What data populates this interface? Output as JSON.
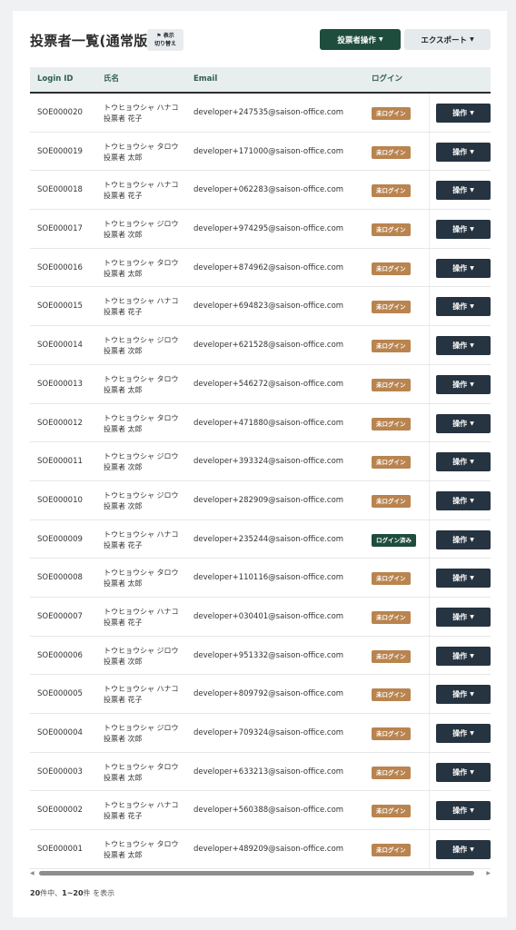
{
  "header": {
    "title": "投票者一覧(通常版)",
    "toggle_line1": "表示",
    "toggle_line2": "切り替え",
    "voter_ops_label": "投票者操作",
    "export_label": "エクスポート"
  },
  "table": {
    "columns": [
      "Login ID",
      "氏名",
      "Email",
      "ログイン"
    ],
    "op_label": "操作",
    "rows": [
      {
        "id": "SOE000020",
        "kana": "トウヒョウシャ ハナコ",
        "name": "投票者 花子",
        "email": "developer+247535@saison-office.com",
        "status": "未ログイン",
        "logged": false
      },
      {
        "id": "SOE000019",
        "kana": "トウヒョウシャ タロウ",
        "name": "投票者 太郎",
        "email": "developer+171000@saison-office.com",
        "status": "未ログイン",
        "logged": false
      },
      {
        "id": "SOE000018",
        "kana": "トウヒョウシャ ハナコ",
        "name": "投票者 花子",
        "email": "developer+062283@saison-office.com",
        "status": "未ログイン",
        "logged": false
      },
      {
        "id": "SOE000017",
        "kana": "トウヒョウシャ ジロウ",
        "name": "投票者 次郎",
        "email": "developer+974295@saison-office.com",
        "status": "未ログイン",
        "logged": false
      },
      {
        "id": "SOE000016",
        "kana": "トウヒョウシャ タロウ",
        "name": "投票者 太郎",
        "email": "developer+874962@saison-office.com",
        "status": "未ログイン",
        "logged": false
      },
      {
        "id": "SOE000015",
        "kana": "トウヒョウシャ ハナコ",
        "name": "投票者 花子",
        "email": "developer+694823@saison-office.com",
        "status": "未ログイン",
        "logged": false
      },
      {
        "id": "SOE000014",
        "kana": "トウヒョウシャ ジロウ",
        "name": "投票者 次郎",
        "email": "developer+621528@saison-office.com",
        "status": "未ログイン",
        "logged": false
      },
      {
        "id": "SOE000013",
        "kana": "トウヒョウシャ タロウ",
        "name": "投票者 太郎",
        "email": "developer+546272@saison-office.com",
        "status": "未ログイン",
        "logged": false
      },
      {
        "id": "SOE000012",
        "kana": "トウヒョウシャ タロウ",
        "name": "投票者 太郎",
        "email": "developer+471880@saison-office.com",
        "status": "未ログイン",
        "logged": false
      },
      {
        "id": "SOE000011",
        "kana": "トウヒョウシャ ジロウ",
        "name": "投票者 次郎",
        "email": "developer+393324@saison-office.com",
        "status": "未ログイン",
        "logged": false
      },
      {
        "id": "SOE000010",
        "kana": "トウヒョウシャ ジロウ",
        "name": "投票者 次郎",
        "email": "developer+282909@saison-office.com",
        "status": "未ログイン",
        "logged": false
      },
      {
        "id": "SOE000009",
        "kana": "トウヒョウシャ ハナコ",
        "name": "投票者 花子",
        "email": "developer+235244@saison-office.com",
        "status": "ログイン済み",
        "logged": true
      },
      {
        "id": "SOE000008",
        "kana": "トウヒョウシャ タロウ",
        "name": "投票者 太郎",
        "email": "developer+110116@saison-office.com",
        "status": "未ログイン",
        "logged": false
      },
      {
        "id": "SOE000007",
        "kana": "トウヒョウシャ ハナコ",
        "name": "投票者 花子",
        "email": "developer+030401@saison-office.com",
        "status": "未ログイン",
        "logged": false
      },
      {
        "id": "SOE000006",
        "kana": "トウヒョウシャ ジロウ",
        "name": "投票者 次郎",
        "email": "developer+951332@saison-office.com",
        "status": "未ログイン",
        "logged": false
      },
      {
        "id": "SOE000005",
        "kana": "トウヒョウシャ ハナコ",
        "name": "投票者 花子",
        "email": "developer+809792@saison-office.com",
        "status": "未ログイン",
        "logged": false
      },
      {
        "id": "SOE000004",
        "kana": "トウヒョウシャ ジロウ",
        "name": "投票者 次郎",
        "email": "developer+709324@saison-office.com",
        "status": "未ログイン",
        "logged": false
      },
      {
        "id": "SOE000003",
        "kana": "トウヒョウシャ タロウ",
        "name": "投票者 太郎",
        "email": "developer+633213@saison-office.com",
        "status": "未ログイン",
        "logged": false
      },
      {
        "id": "SOE000002",
        "kana": "トウヒョウシャ ハナコ",
        "name": "投票者 花子",
        "email": "developer+560388@saison-office.com",
        "status": "未ログイン",
        "logged": false
      },
      {
        "id": "SOE000001",
        "kana": "トウヒョウシャ タロウ",
        "name": "投票者 太郎",
        "email": "developer+489209@saison-office.com",
        "status": "未ログイン",
        "logged": false
      }
    ]
  },
  "footer": {
    "total": "20",
    "total_unit": "件中、",
    "range": "1~20",
    "range_unit": "件 を表示"
  },
  "icons": {
    "flag": "flag-icon",
    "caret": "caret-down-icon",
    "scroll_left": "scroll-left-arrow-icon",
    "scroll_right": "scroll-right-arrow-icon"
  },
  "colors": {
    "primary": "#1e4d3d",
    "not_logged_badge": "#b9844f",
    "logged_badge": "#1e4d3d",
    "op_button": "#263340",
    "header_bg": "#e8eeed"
  }
}
